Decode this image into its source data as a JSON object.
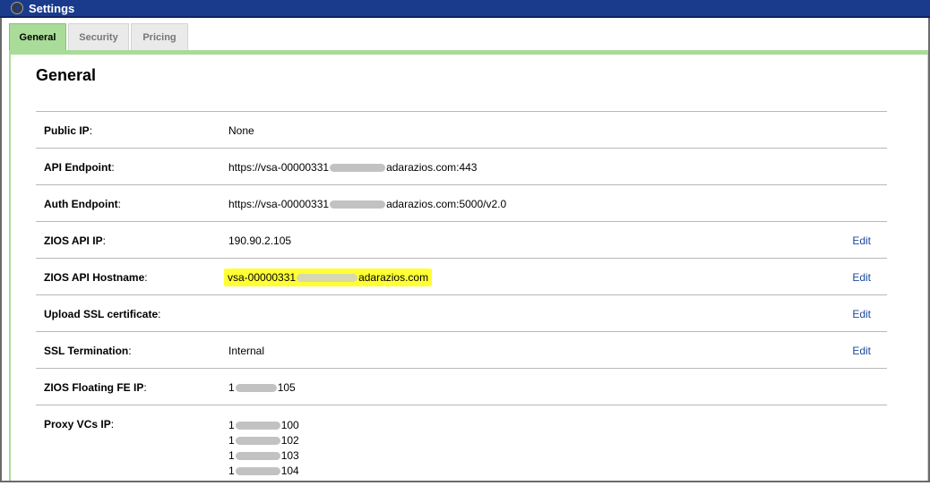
{
  "window": {
    "title": "Settings"
  },
  "tabs": [
    {
      "label": "General",
      "active": true
    },
    {
      "label": "Security",
      "active": false
    },
    {
      "label": "Pricing",
      "active": false
    }
  ],
  "section": {
    "title": "General"
  },
  "rows": {
    "public_ip": {
      "label": "Public IP",
      "value": "None"
    },
    "api_endpoint": {
      "label": "API Endpoint",
      "value_prefix": "https://vsa-00000331",
      "value_suffix": "adarazios.com:443"
    },
    "auth_endpoint": {
      "label": "Auth Endpoint",
      "value_prefix": "https://vsa-00000331",
      "value_suffix": "adarazios.com:5000/v2.0"
    },
    "zios_api_ip": {
      "label": "ZIOS API IP",
      "value": "190.90.2.105",
      "action": "Edit"
    },
    "zios_api_hostname": {
      "label": "ZIOS API Hostname",
      "value_prefix": "vsa-00000331",
      "value_suffix": "adarazios.com",
      "action": "Edit"
    },
    "upload_ssl": {
      "label": "Upload SSL certificate",
      "action": "Edit"
    },
    "ssl_termination": {
      "label": "SSL Termination",
      "value": "Internal",
      "action": "Edit"
    },
    "floating_fe_ip": {
      "label": "ZIOS Floating FE IP",
      "value_prefix": "1",
      "value_suffix": "105"
    },
    "proxy_vcs_ip": {
      "label": "Proxy VCs IP",
      "values": [
        {
          "prefix": "1",
          "suffix": "100"
        },
        {
          "prefix": "1",
          "suffix": "102"
        },
        {
          "prefix": "1",
          "suffix": "103"
        },
        {
          "prefix": "1",
          "suffix": "104"
        }
      ]
    }
  },
  "colors": {
    "titlebar": "#1a3a8c",
    "tab_active": "#a8dc98",
    "highlight": "#ffff33",
    "link": "#1a4a9a"
  },
  "label_suffix": ":"
}
